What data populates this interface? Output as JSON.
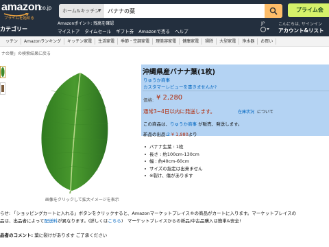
{
  "header": {
    "logo_text": "amazon",
    "logo_tld": ".co.jp",
    "logo_sub": "プライムを始める",
    "search_category": "ホーム&キッチン",
    "search_value": "バナナの葉",
    "prime_banner": "プライム会",
    "category_menu": "カテゴリー",
    "promo": "Amazonポイント: 残高を確認",
    "nav": [
      "マイストア",
      "タイムセール",
      "ギフト券",
      "Amazonで売る",
      "ヘルプ"
    ],
    "lang": "JP",
    "account_hello": "こんにちは, サインイン",
    "account_main": "アカウント&リスト"
  },
  "category_strip": [
    "ッチン",
    "Amazonランキング",
    "キッチン家電",
    "生活家電",
    "季節・空調家電",
    "理美容家電",
    "健康家電",
    "掃除",
    "大型家電",
    "浄水器",
    "お買い"
  ],
  "breadcrumb": "ナの葉」の検索結果に戻る",
  "image": {
    "caption": "画像をクリックして拡大イメージを表示"
  },
  "product": {
    "title": "沖縄県産バナナ葉(1枚)",
    "seller": "りゅうか商事",
    "review_link": "カスタマーレビューを書きませんか?",
    "price_label": "価格:",
    "price": "¥ 2,280",
    "shipping": "通常3~4日以内に発送します。",
    "stock_link": "在庫状況",
    "stock_suffix": "について",
    "sold_by_prefix": "この商品は、",
    "sold_by_link": "りゅうか商事",
    "sold_by_suffix": " が販売、発送します。",
    "new_offers_prefix": "新品の出品:",
    "new_offers_count": "2",
    "new_offers_price": "¥ 1,980",
    "new_offers_suffix": "より"
  },
  "bullets": [
    "バナナ生葉 : 1枚",
    "長さ : 約100cm-130cm",
    "幅 : 約40cm-60cm",
    "サイズの指定は出来ません",
    "※裂け、傷があります"
  ],
  "notices": {
    "line1": "らせ: 「ショッピングカートに入れる」ボタンをクリックすると、Amazonマーケットプレイス®の商品がカートに入ります。マーケットプレイスの",
    "line2_a": "品は、出品者によって",
    "line2_link1": "配送料",
    "line2_b": "が異なります。(詳しくは",
    "line2_link2": "こちら",
    "line2_c": ")　マーケットプレイスからの新品/中古品購入は簡単&安全!"
  },
  "comment": {
    "label": "品者のコメント:",
    "text": "葉に裂けがあります ご了承ください"
  },
  "colors": {
    "header_bg": "#232f3e",
    "search_button": "#febd69",
    "price_red": "#b12704",
    "link_blue": "#0066c0",
    "selection_blue": "#b4d3f3"
  }
}
